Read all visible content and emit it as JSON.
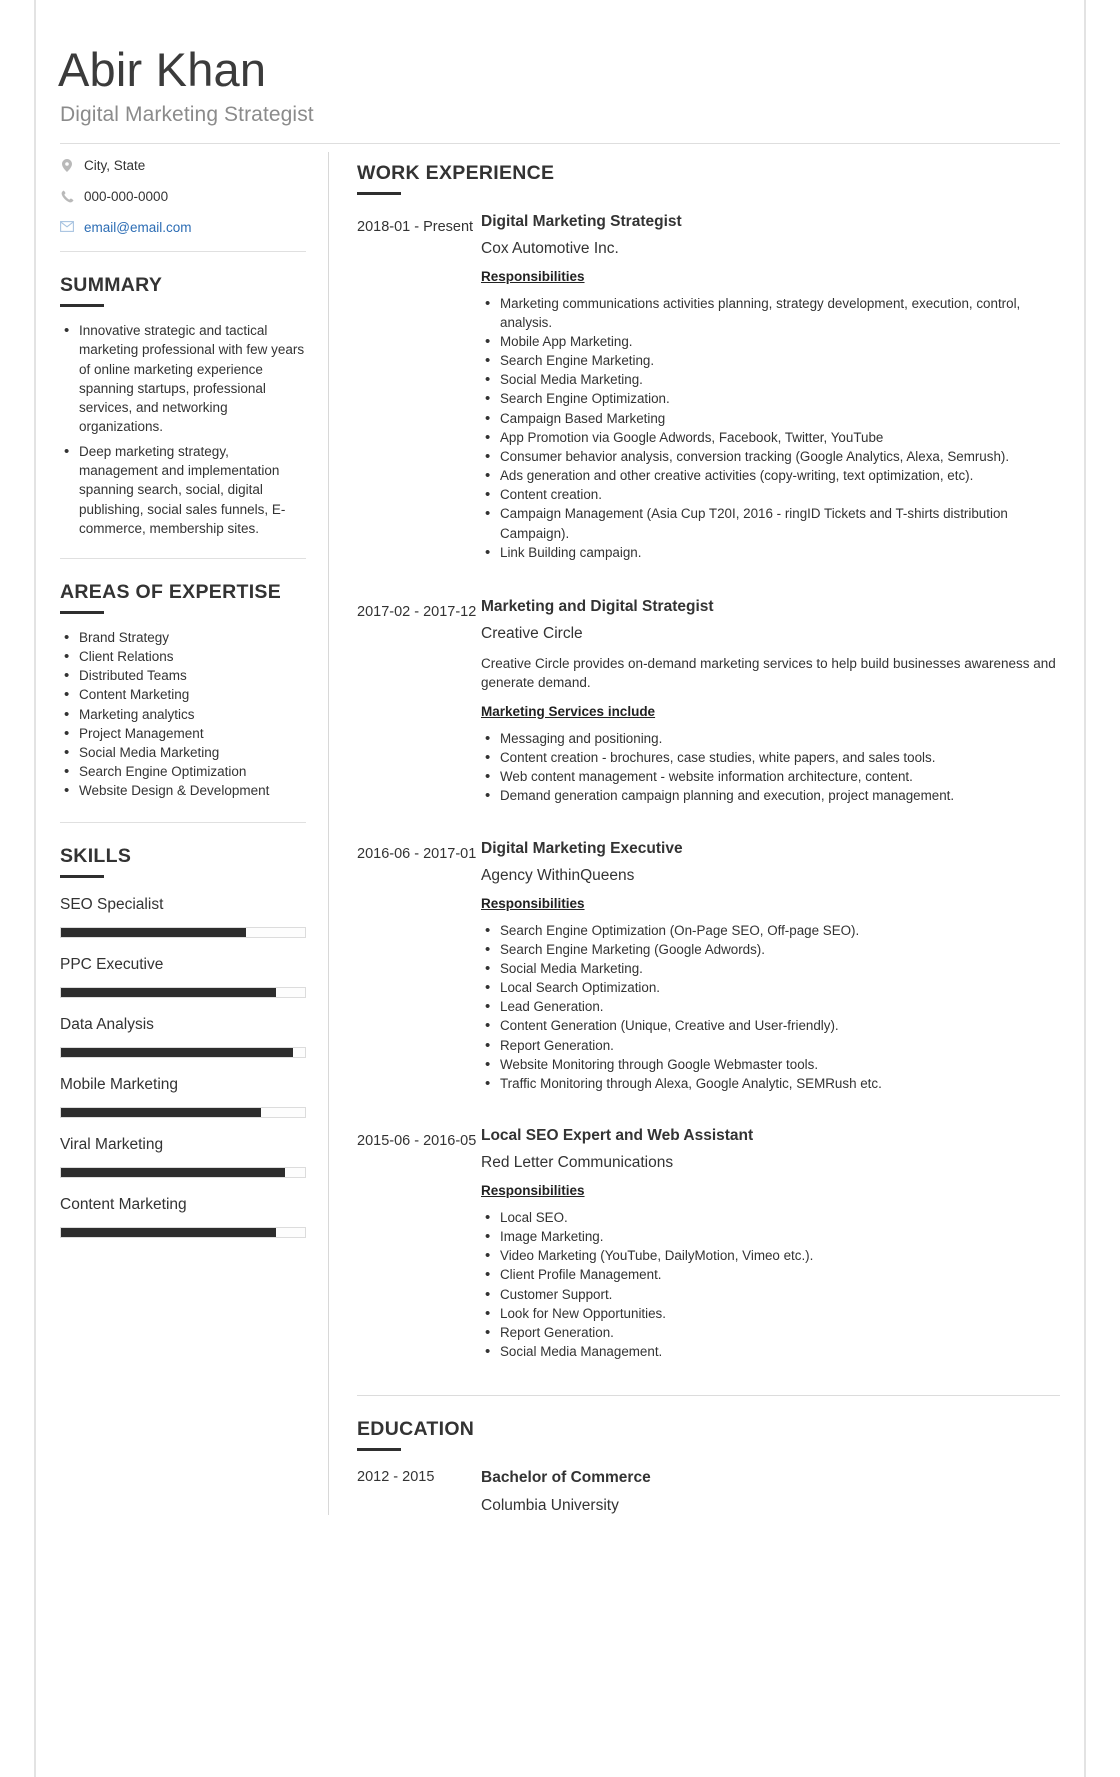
{
  "header": {
    "name": "Abir Khan",
    "headline": "Digital Marketing Strategist"
  },
  "contact": {
    "location": {
      "icon": "location-pin-icon",
      "text": "City, State"
    },
    "phone": {
      "icon": "phone-icon",
      "text": "000-000-0000"
    },
    "email": {
      "icon": "envelope-icon",
      "text": "email@email.com",
      "color": "#2b6cb4"
    }
  },
  "summary": {
    "heading": "SUMMARY",
    "items": [
      "Innovative strategic and tactical marketing professional with few years of online marketing experience spanning startups, professional services, and networking organizations.",
      "Deep marketing strategy, management and implementation spanning search, social, digital publishing, social sales funnels, E-commerce, membership sites."
    ]
  },
  "expertise": {
    "heading": "AREAS OF EXPERTISE",
    "items": [
      "Brand Strategy",
      "Client Relations",
      "Distributed Teams",
      "Content Marketing",
      "Marketing analytics",
      "Project Management",
      "Social Media Marketing",
      "Search Engine Optimization",
      "Website Design & Development"
    ]
  },
  "skills": {
    "heading": "SKILLS",
    "items": [
      {
        "name": "SEO Specialist",
        "level": 76
      },
      {
        "name": "PPC Executive",
        "level": 88
      },
      {
        "name": "Data Analysis",
        "level": 95
      },
      {
        "name": "Mobile Marketing",
        "level": 82
      },
      {
        "name": "Viral Marketing",
        "level": 92
      },
      {
        "name": "Content Marketing",
        "level": 88
      }
    ]
  },
  "work": {
    "heading": "WORK EXPERIENCE",
    "jobs": [
      {
        "dates": "2018-01 - Present",
        "title": "Digital Marketing Strategist",
        "org": "Cox Automotive Inc.",
        "desc": "",
        "sub_heading": "Responsibilities",
        "bullets": [
          "Marketing communications activities planning, strategy development, execution, control, analysis.",
          "Mobile App Marketing.",
          "Search Engine Marketing.",
          "Social Media Marketing.",
          "Search Engine Optimization.",
          "Campaign Based Marketing",
          "App Promotion via Google Adwords, Facebook, Twitter, YouTube",
          "Consumer behavior analysis, conversion tracking (Google Analytics, Alexa, Semrush).",
          "Ads generation and other creative activities (copy-writing, text optimization, etc).",
          "Content creation.",
          "Campaign Management (Asia Cup T20I, 2016 - ringID Tickets and T-shirts distribution Campaign).",
          "Link Building campaign."
        ]
      },
      {
        "dates": "2017-02 - 2017-12",
        "title": "Marketing and Digital Strategist",
        "org": "Creative Circle",
        "desc": "Creative Circle provides on-demand marketing services to help build businesses awareness and generate demand.",
        "sub_heading": "Marketing Services include",
        "bullets": [
          "Messaging and positioning.",
          "Content creation - brochures, case studies, white papers, and sales tools.",
          "Web content management - website information architecture, content.",
          "Demand generation campaign planning and execution, project management."
        ]
      },
      {
        "dates": "2016-06 - 2017-01",
        "title": "Digital Marketing Executive",
        "org": "Agency WithinQueens",
        "desc": "",
        "sub_heading": "Responsibilities",
        "bullets": [
          "Search Engine Optimization (On-Page SEO, Off-page SEO).",
          "Search Engine Marketing (Google Adwords).",
          "Social Media Marketing.",
          "Local Search Optimization.",
          "Lead Generation.",
          "Content Generation (Unique, Creative and User-friendly).",
          "Report Generation.",
          "Website Monitoring through Google Webmaster tools.",
          "Traffic Monitoring through Alexa, Google Analytic, SEMRush etc."
        ]
      },
      {
        "dates": "2015-06 - 2016-05",
        "title": "Local SEO Expert and Web Assistant",
        "org": "Red Letter Communications",
        "desc": "",
        "sub_heading": "Responsibilities",
        "bullets": [
          "Local SEO.",
          "Image Marketing.",
          "Video Marketing (YouTube, DailyMotion, Vimeo etc.).",
          "Client Profile Management.",
          "Customer Support.",
          "Look for New Opportunities.",
          "Report Generation.",
          "Social Media Management."
        ]
      }
    ]
  },
  "education": {
    "heading": "EDUCATION",
    "items": [
      {
        "dates": "2012 - 2015",
        "title": "Bachelor of Commerce",
        "school": "Columbia University"
      }
    ]
  }
}
